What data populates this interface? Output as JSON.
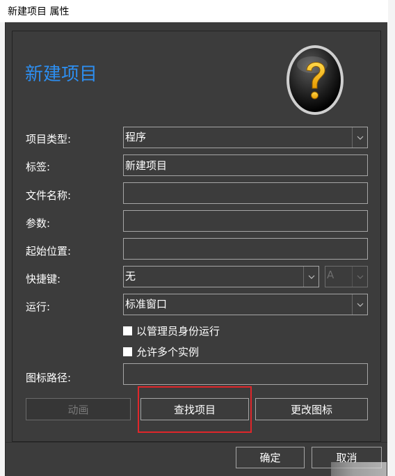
{
  "window": {
    "title": "新建项目 属性"
  },
  "heading": "新建项目",
  "fields": {
    "type": {
      "label": "项目类型:",
      "value": "程序"
    },
    "tag": {
      "label": "标签:",
      "value": "新建项目"
    },
    "filename": {
      "label": "文件名称:",
      "value": ""
    },
    "params": {
      "label": "参数:",
      "value": ""
    },
    "startdir": {
      "label": "起始位置:",
      "value": ""
    },
    "hotkey": {
      "label": "快捷键:",
      "value": "无",
      "key_value": "A"
    },
    "run": {
      "label": "运行:",
      "value": "标准窗口"
    },
    "iconpath": {
      "label": "图标路径:",
      "value": ""
    }
  },
  "checkboxes": {
    "admin": "以管理员身份运行",
    "multi": "允许多个实例"
  },
  "buttons": {
    "animate": "动画",
    "find": "查找项目",
    "change_icon": "更改图标",
    "ok": "确定",
    "cancel": "取消"
  },
  "colors": {
    "accent": "#2d8ef0",
    "highlight": "#e0262a",
    "background": "#3c3c3c"
  },
  "icons": {
    "help": "question-mark-icon",
    "dropdown": "chevron-down-icon"
  }
}
